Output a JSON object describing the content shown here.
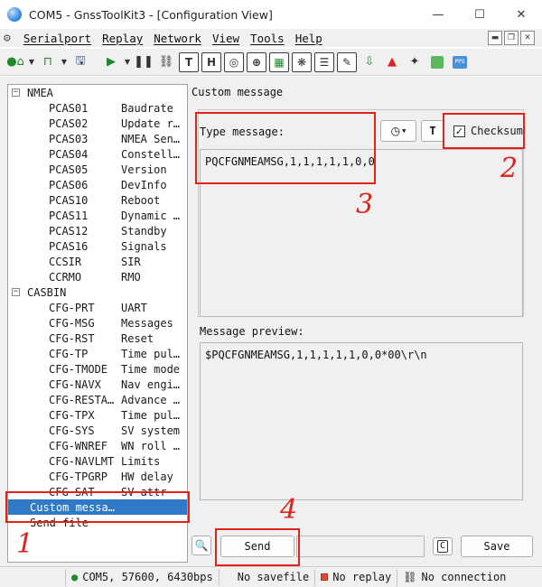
{
  "window": {
    "title": "COM5 - GnssToolKit3 - [Configuration View]",
    "controls": [
      "minimize",
      "maximize",
      "close"
    ]
  },
  "menubar": {
    "items": [
      "Serialport",
      "Replay",
      "Network",
      "View",
      "Tools",
      "Help"
    ]
  },
  "toolbar": {
    "icons": [
      "serial-connect-icon",
      "waveform-icon",
      "save-icon",
      "play-icon",
      "pause-icon",
      "microphone-icon",
      "text-view-icon",
      "hex-view-icon",
      "target-icon",
      "position-icon",
      "chart-icon",
      "settings-icon",
      "list-icon",
      "edit-icon",
      "download-icon",
      "compass-icon",
      "satellite-icon",
      "map-icon",
      "pps-icon"
    ],
    "text_button": "T",
    "hex_button": "H",
    "pps_label": "PPS"
  },
  "tree": {
    "groups": [
      {
        "name": "NMEA",
        "expander": "−",
        "items": [
          {
            "id": "PCAS01",
            "desc": "Baudrate"
          },
          {
            "id": "PCAS02",
            "desc": "Update r…"
          },
          {
            "id": "PCAS03",
            "desc": "NMEA Sen…"
          },
          {
            "id": "PCAS04",
            "desc": "Constell…"
          },
          {
            "id": "PCAS05",
            "desc": "Version"
          },
          {
            "id": "PCAS06",
            "desc": "DevInfo"
          },
          {
            "id": "PCAS10",
            "desc": "Reboot"
          },
          {
            "id": "PCAS11",
            "desc": "Dynamic …"
          },
          {
            "id": "PCAS12",
            "desc": "Standby"
          },
          {
            "id": "PCAS16",
            "desc": "Signals"
          },
          {
            "id": "CCSIR",
            "desc": "SIR"
          },
          {
            "id": "CCRMO",
            "desc": "RMO"
          }
        ]
      },
      {
        "name": "CASBIN",
        "expander": "−",
        "items": [
          {
            "id": "CFG-PRT",
            "desc": "UART"
          },
          {
            "id": "CFG-MSG",
            "desc": "Messages"
          },
          {
            "id": "CFG-RST",
            "desc": "Reset"
          },
          {
            "id": "CFG-TP",
            "desc": "Time pul…"
          },
          {
            "id": "CFG-TMODE",
            "desc": "Time mode"
          },
          {
            "id": "CFG-NAVX",
            "desc": "Nav engi…"
          },
          {
            "id": "CFG-RESTA…",
            "desc": "Advance …"
          },
          {
            "id": "CFG-TPX",
            "desc": "Time pul…"
          },
          {
            "id": "CFG-SYS",
            "desc": "SV system"
          },
          {
            "id": "CFG-WNREF",
            "desc": "WN roll …"
          },
          {
            "id": "CFG-NAVLMT",
            "desc": "Limits"
          },
          {
            "id": "CFG-TPGRP",
            "desc": "HW delay"
          },
          {
            "id": "CFG-SAT",
            "desc": "SV attr"
          }
        ]
      }
    ],
    "leaves": [
      "Custom messa…",
      "Send file"
    ],
    "selected_leaf": "Custom messa…"
  },
  "panel": {
    "title": "Custom message",
    "type_label": "Type message:",
    "checksum_label": "Checksum",
    "checksum_checked": true,
    "checkmark": "✓",
    "message_text": "PQCFGNMEAMSG,1,1,1,1,1,0,0",
    "preview_label": "Message preview:",
    "preview_text": "$PQCFGNMEAMSG,1,1,1,1,1,0,0*00\\r\\n",
    "send_label": "Send",
    "clear_label": "C",
    "save_label": "Save",
    "text_format_button": "T"
  },
  "annotations": [
    "1",
    "2",
    "3",
    "4"
  ],
  "annotation_color": "#e0241b",
  "statusbar": {
    "port": "COM5, 57600, 6430bps",
    "savefile": "No savefile",
    "replay": "No replay",
    "connection": "No connection"
  },
  "colors": {
    "selection": "#2f79c7",
    "toolbar_green": "#1b8a2a"
  }
}
